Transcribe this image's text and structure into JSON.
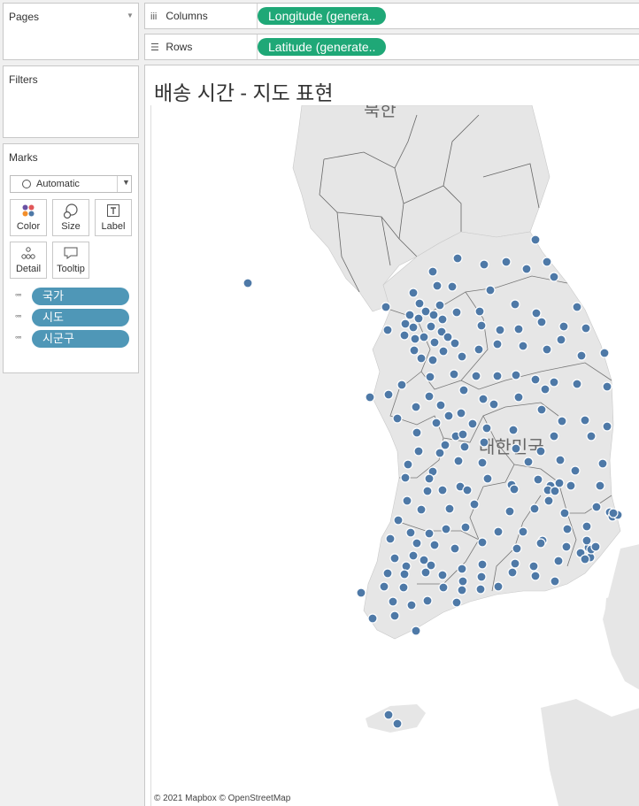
{
  "side": {
    "pages_title": "Pages",
    "filters_title": "Filters",
    "marks_title": "Marks",
    "mark_type": "Automatic",
    "mark_buttons": [
      {
        "label": "Color",
        "icon": "color-dots-icon"
      },
      {
        "label": "Size",
        "icon": "size-circles-icon"
      },
      {
        "label": "Label",
        "icon": "text-label-icon"
      },
      {
        "label": "Detail",
        "icon": "detail-dots-icon"
      },
      {
        "label": "Tooltip",
        "icon": "speech-bubble-icon"
      }
    ],
    "mark_fields": [
      "국가",
      "시도",
      "시군구"
    ]
  },
  "shelves": {
    "columns": {
      "label": "Columns",
      "pill": "Longitude (genera..",
      "icon": "columns-bars-icon"
    },
    "rows": {
      "label": "Rows",
      "pill": "Latitude (generate..",
      "icon": "rows-lines-icon"
    }
  },
  "viz": {
    "title": "배송 시간 - 지도 표현",
    "map_labels": {
      "north": "북한",
      "south": "대한민국"
    },
    "attribution": "© 2021 Mapbox © OpenStreetMap",
    "mark_color": "#4e79a7",
    "land_color": "#e6e6e6",
    "sea_color": "#ffffff",
    "accent_pill_color": "#1fa877",
    "dimension_pill_color": "#4f97b7"
  }
}
